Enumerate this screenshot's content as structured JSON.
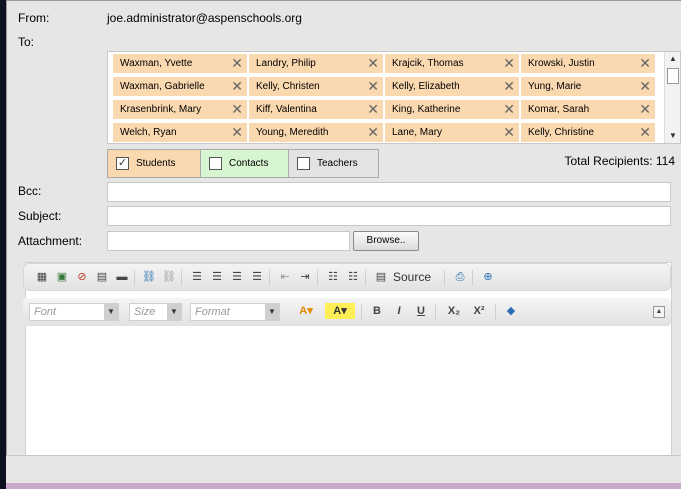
{
  "labels": {
    "from": "From:",
    "to": "To:",
    "bcc": "Bcc:",
    "subject": "Subject:",
    "attachment": "Attachment:"
  },
  "from_value": "joe.administrator@aspenschools.org",
  "recipients": [
    "Waxman, Yvette",
    "Landry, Philip",
    "Krajcik, Thomas",
    "Krowski, Justin",
    "Waxman, Gabrielle",
    "Kelly, Christen",
    "Kelly, Elizabeth",
    "Yung, Marie",
    "Krasenbrink, Mary",
    "Kiff, Valentina",
    "King, Katherine",
    "Komar, Sarah",
    "Welch, Ryan",
    "Young, Meredith",
    "Lane, Mary",
    "Kelly, Christine"
  ],
  "filters": {
    "students": {
      "label": "Students",
      "checked": true,
      "color": "#fad8b0"
    },
    "contacts": {
      "label": "Contacts",
      "checked": false,
      "color": "#d7f5d0"
    },
    "teachers": {
      "label": "Teachers",
      "checked": false,
      "color": "#e3e3e3"
    }
  },
  "total_recipients": "Total Recipients: 114",
  "inputs": {
    "bcc": "",
    "subject": "",
    "attachment": ""
  },
  "browse_label": "Browse..",
  "toolbar": {
    "source_label": "Source",
    "font_placeholder": "Font",
    "size_placeholder": "Size",
    "format_placeholder": "Format",
    "bold": "B",
    "italic": "I",
    "underline": "U",
    "subscript": "X₂",
    "superscript": "X²"
  },
  "colors": {
    "chip": "#fad8b0",
    "frame_bg": "#e6e6e6",
    "outer_bg": "#0b1120"
  }
}
